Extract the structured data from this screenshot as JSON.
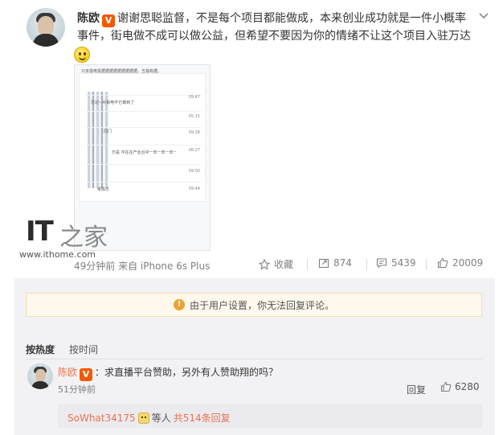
{
  "post": {
    "author": "陈欧",
    "v_badge": "V",
    "text_line1": "谢谢思聪监督，不是每个项目都能做成，本来创业成功就是一件小概率",
    "text_line2": "事件，街电做不成可以做公益，但希望不要因为你的情绪不让这个项目入驻万达",
    "time_source": "49分钟前 来自 iPhone 6s Plus"
  },
  "screenshot": {
    "top_text": "只京需电需据据据据据据据据据。五临有据。",
    "rows": [
      {
        "text": "万达~片街电平已做到了",
        "time": "09:47"
      },
      {
        "text": "",
        "time": "05:15"
      },
      {
        "text": "同门",
        "time": "09:28"
      },
      {
        "text": "万是 平在在产业台中一年一年一年一年有",
        "time": "06:27"
      },
      {
        "text": "",
        "time": "09:00"
      },
      {
        "text": "考陈乐",
        "time": "09:44"
      }
    ]
  },
  "watermark": {
    "logo": "IT",
    "logo2": "之家",
    "url": "www.ithome.com"
  },
  "actions": {
    "favorite": "收藏",
    "repost": "874",
    "comments": "5439",
    "likes": "20009"
  },
  "notice": "由于用户设置，你无法回复评论。",
  "sort": {
    "hot": "按热度",
    "time": "按时间"
  },
  "comment": {
    "author": "陈欧",
    "v_badge": "V",
    "text": "：求直播平台赞助，另外有人赞助翔的吗？",
    "time": "51分钟前",
    "reply_label": "回复",
    "likes": "6280",
    "reply_summary": {
      "user": "SoWhat34175",
      "middle": "等人",
      "total": "共514条回复"
    }
  },
  "colors": {
    "link_orange": "#eb7350",
    "v_badge": "#f35a00",
    "notice_bg": "#fff8ec",
    "comment_bg": "#f2f2f5"
  },
  "icons": [
    "chevron-down-icon",
    "star-icon",
    "repost-icon",
    "comment-icon",
    "thumbs-up-icon",
    "warning-icon",
    "smiley-icon"
  ]
}
